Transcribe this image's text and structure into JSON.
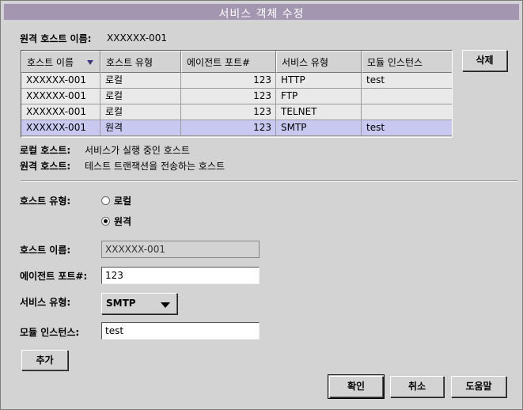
{
  "window": {
    "title": "서비스 객체 수정"
  },
  "remote_host_name": {
    "label": "원격 호스트 이름:",
    "value": "XXXXXX-001"
  },
  "table": {
    "columns": [
      "호스트 이름",
      "호스트 유형",
      "에이전트 포트#",
      "서비스 유형",
      "모듈 인스턴스"
    ],
    "rows": [
      [
        "XXXXXX-001",
        "로컬",
        "123",
        "HTTP",
        "test"
      ],
      [
        "XXXXXX-001",
        "로컬",
        "123",
        "FTP",
        ""
      ],
      [
        "XXXXXX-001",
        "로컬",
        "123",
        "TELNET",
        ""
      ],
      [
        "XXXXXX-001",
        "원격",
        "123",
        "SMTP",
        "test"
      ]
    ],
    "selected_row": 3
  },
  "delete_button": "삭제",
  "legend": {
    "local_label": "로컬 호스트:",
    "local_desc": "서비스가 실행 중인 호스트",
    "remote_label": "원격 호스트:",
    "remote_desc": "테스트 트랜잭션을 전송하는 호스트"
  },
  "form": {
    "host_type_label": "호스트 유형:",
    "radio_local": "로컬",
    "radio_remote": "원격",
    "host_name_label": "호스트 이름:",
    "host_name_value": "XXXXXX-001",
    "agent_port_label": "에이전트 포트#:",
    "agent_port_value": "123",
    "service_type_label": "서비스 유형:",
    "service_type_value": "SMTP",
    "module_instance_label": "모듈 인스턴스:",
    "module_instance_value": "test",
    "add_button": "추가"
  },
  "footer": {
    "ok": "확인",
    "cancel": "취소",
    "help": "도움말"
  }
}
